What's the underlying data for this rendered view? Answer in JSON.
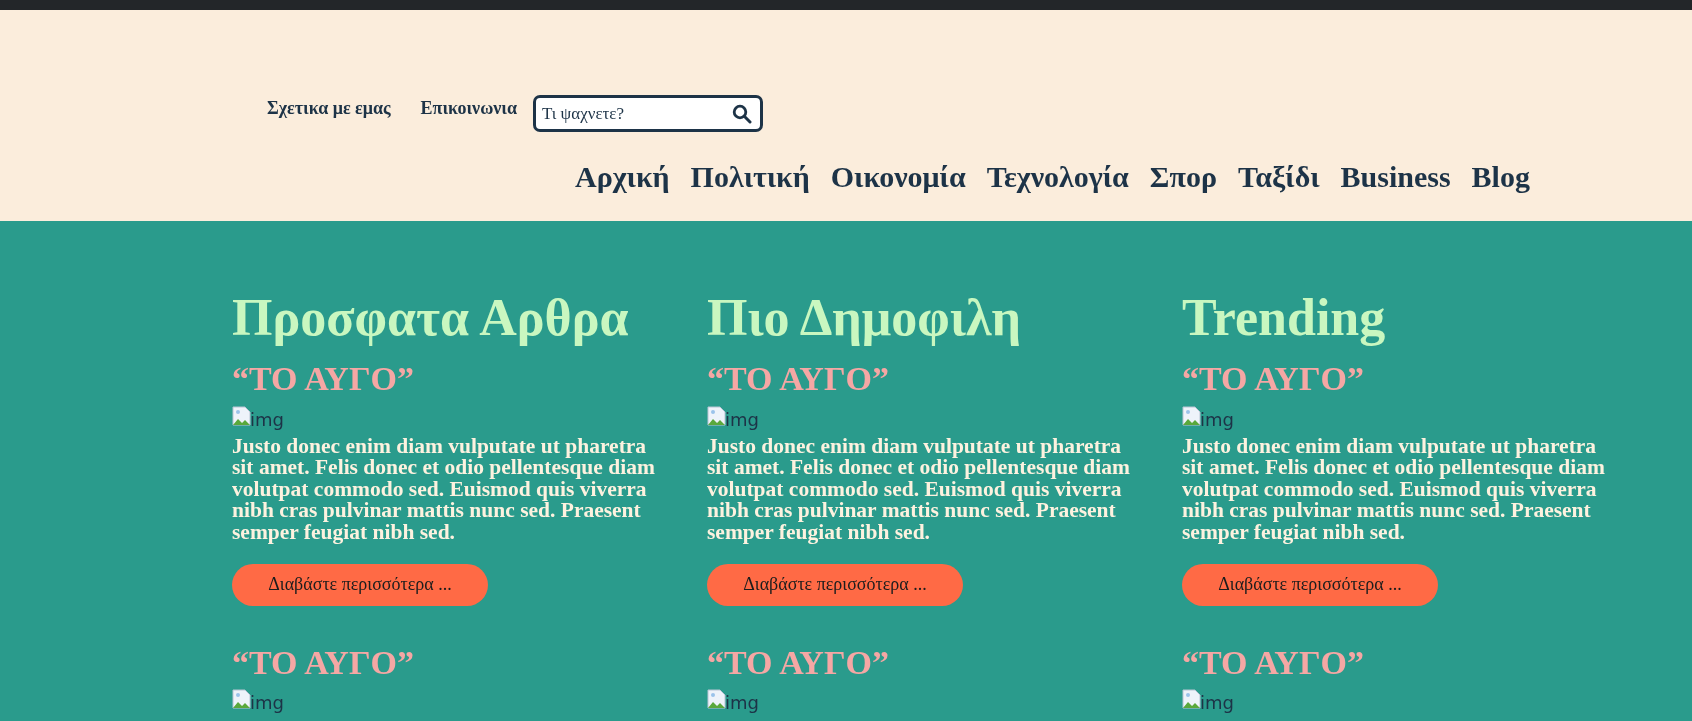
{
  "top_links": [
    "Σχετικα με εμας",
    "Επικοινωνια"
  ],
  "search": {
    "placeholder": "Τι ψαχνετε?"
  },
  "nav": [
    "Αρχική",
    "Πολιτική",
    "Οικονομία",
    "Τεχνολογία",
    "Σπορ",
    "Ταξίδι",
    "Business",
    "Blog"
  ],
  "columns": [
    {
      "title": "Προσφατα Αρθρα",
      "articles": [
        {
          "headline": "“ΤΟ ΑΥΓΟ”",
          "image_alt": "img",
          "text": "Justo donec enim diam vulputate ut pharetra sit amet. Felis donec et odio pellentesque diam volutpat commodo sed. Euismod quis viverra nibh cras pulvinar mattis nunc sed. Praesent semper feugiat nibh sed.",
          "button": "Διαβάστε περισσότερα ..."
        },
        {
          "headline": "“ΤΟ ΑΥΓΟ”",
          "image_alt": "img"
        }
      ]
    },
    {
      "title": "Πιο Δημοφιλη",
      "articles": [
        {
          "headline": "“ΤΟ ΑΥΓΟ”",
          "image_alt": "img",
          "text": "Justo donec enim diam vulputate ut pharetra sit amet. Felis donec et odio pellentesque diam volutpat commodo sed. Euismod quis viverra nibh cras pulvinar mattis nunc sed. Praesent semper feugiat nibh sed.",
          "button": "Διαβάστε περισσότερα ..."
        },
        {
          "headline": "“ΤΟ ΑΥΓΟ”",
          "image_alt": "img"
        }
      ]
    },
    {
      "title": "Trending",
      "articles": [
        {
          "headline": "“ΤΟ ΑΥΓΟ”",
          "image_alt": "img",
          "text": "Justo donec enim diam vulputate ut pharetra sit amet. Felis donec et odio pellentesque diam volutpat commodo sed. Euismod quis viverra nibh cras pulvinar mattis nunc sed. Praesent semper feugiat nibh sed.",
          "button": "Διαβάστε περισσότερα ..."
        },
        {
          "headline": "“ΤΟ ΑΥΓΟ”",
          "image_alt": "img"
        }
      ]
    }
  ]
}
